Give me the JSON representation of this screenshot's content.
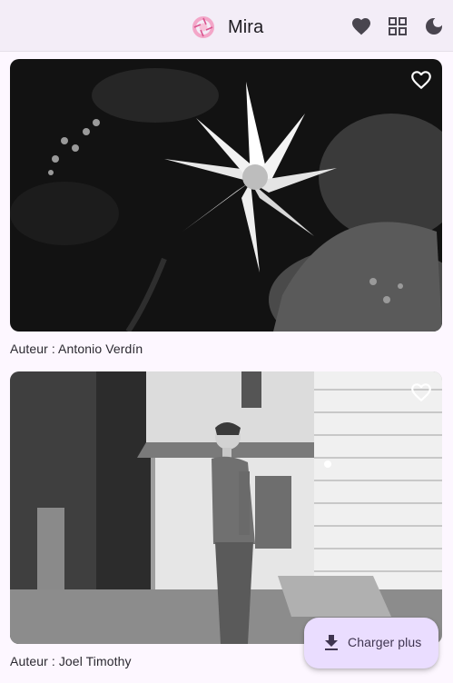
{
  "app_bar": {
    "title": "Mira",
    "logo_icon": "camera-aperture-icon",
    "actions": [
      {
        "name": "favorites",
        "icon": "heart-filled-icon"
      },
      {
        "name": "layout",
        "icon": "grid-icon"
      },
      {
        "name": "theme",
        "icon": "moon-icon"
      }
    ]
  },
  "feed": {
    "items": [
      {
        "photo_icon": "heart-outline-icon",
        "author": "Auteur : Antonio Verdín"
      },
      {
        "photo_icon": "heart-outline-icon",
        "author": "Auteur : Joel Timothy"
      }
    ]
  },
  "fab": {
    "label": "Charger plus",
    "icon": "download-icon"
  },
  "colors": {
    "background": "#fdf7ff",
    "app_bar": "#f3edf7",
    "fab": "#eaddff",
    "logo": "#e57dab"
  }
}
